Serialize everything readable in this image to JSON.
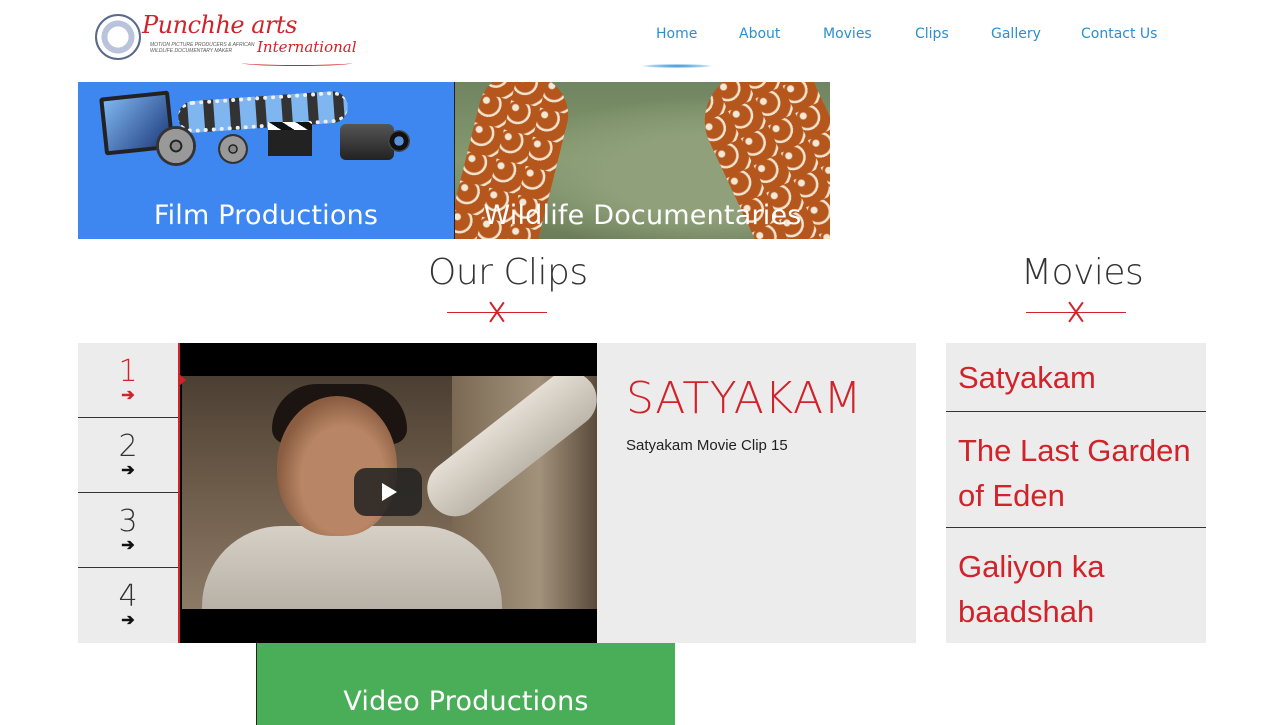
{
  "header": {
    "logo": {
      "name": "Punchhe arts",
      "tagline": "MOTION PICTURE PRODUCERS & AFRICAN WILDLIFE DOCUMENTARY MAKER",
      "intl": "International"
    },
    "nav": [
      {
        "label": "Home",
        "active": true
      },
      {
        "label": "About"
      },
      {
        "label": "Movies"
      },
      {
        "label": "Clips"
      },
      {
        "label": "Gallery"
      },
      {
        "label": "Contact Us"
      }
    ],
    "accent_color": "#2b8fd1"
  },
  "banners": [
    {
      "title": "Film Productions",
      "color": "#3e86f0"
    },
    {
      "title": "Video Productions",
      "color": "#4aae59"
    },
    {
      "title": "Wildlife Documentaries"
    }
  ],
  "clips_section": {
    "heading": "Our Clips",
    "tabs": [
      {
        "number": "1",
        "icon": "arrow-right-icon",
        "active": true
      },
      {
        "number": "2",
        "icon": "arrow-right-icon"
      },
      {
        "number": "3",
        "icon": "arrow-right-icon"
      },
      {
        "number": "4",
        "icon": "arrow-right-icon"
      }
    ],
    "current": {
      "title": "SATYAKAM",
      "description": "Satyakam Movie Clip 15"
    }
  },
  "movies_section": {
    "heading": "Movies",
    "items": [
      "Satyakam",
      "The Last Garden of Eden",
      "Galiyon ka baadshah"
    ]
  },
  "colors": {
    "accent_red": "#d0232a",
    "panel_bg": "#ececec"
  }
}
